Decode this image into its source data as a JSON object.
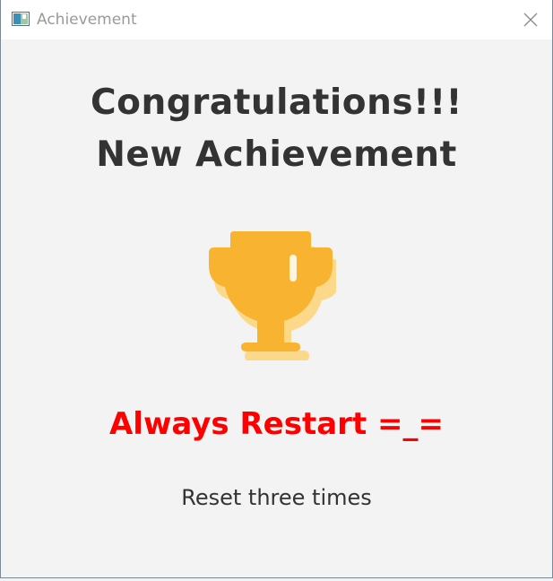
{
  "window": {
    "title": "Achievement",
    "app_icon": "app-window-icon",
    "close_icon": "close-icon"
  },
  "content": {
    "headline_line1": "Congratulations!!!",
    "headline_line2": "New Achievement",
    "icon": "trophy-icon",
    "achievement_name": "Always Restart =_=",
    "achievement_description": "Reset three times"
  },
  "colors": {
    "background": "#f3f3f3",
    "titlebar": "#ffffff",
    "trophy": "#f8b331",
    "trophy_shadow": "#fcd98a",
    "achievement_name": "#ff0000",
    "text": "#333333"
  }
}
